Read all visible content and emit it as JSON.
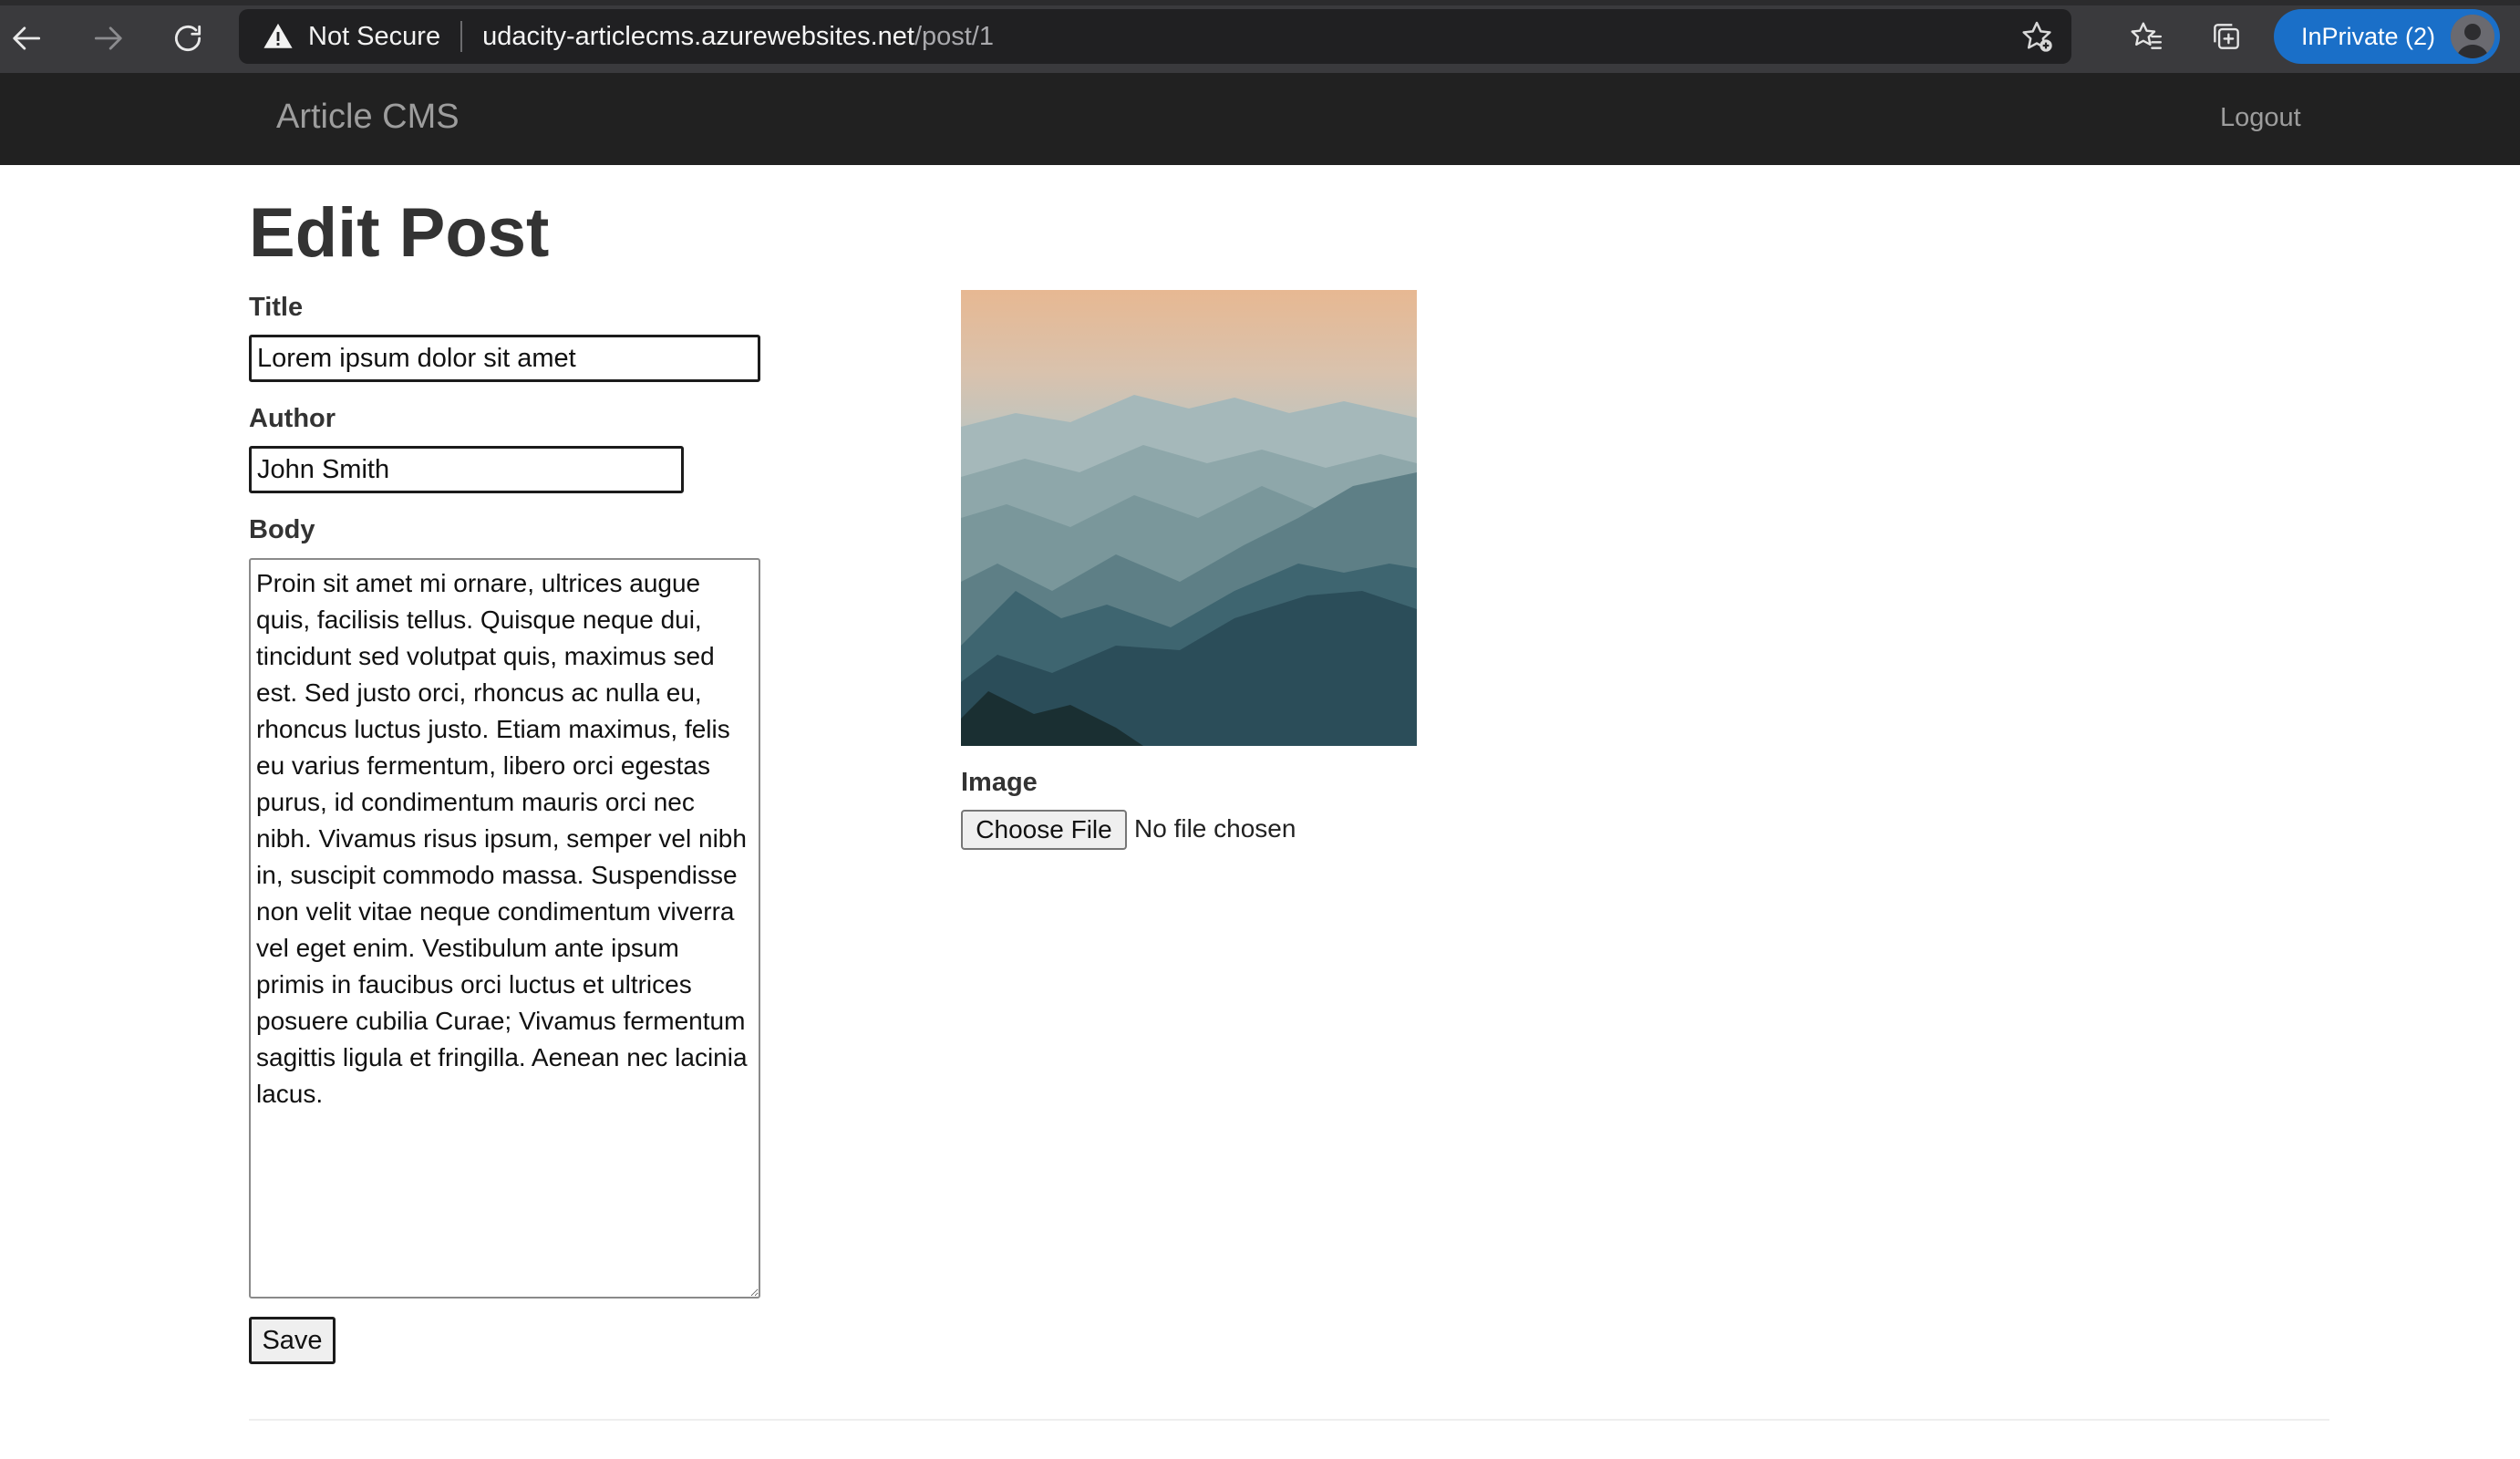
{
  "browser": {
    "security_label": "Not Secure",
    "url_host": "udacity-articlecms.azurewebsites.net",
    "url_path": "/post/1",
    "inprivate_label": "InPrivate (2)"
  },
  "nav": {
    "brand": "Article CMS",
    "logout": "Logout"
  },
  "form": {
    "heading": "Edit Post",
    "title_label": "Title",
    "title_value": "Lorem ipsum dolor sit amet",
    "author_label": "Author",
    "author_value": "John Smith",
    "body_label": "Body",
    "body_value": "Proin sit amet mi ornare, ultrices augue quis, facilisis tellus. Quisque neque dui, tincidunt sed volutpat quis, maximus sed est. Sed justo orci, rhoncus ac nulla eu, rhoncus luctus justo. Etiam maximus, felis eu varius fermentum, libero orci egestas purus, id condimentum mauris orci nec nibh. Vivamus risus ipsum, semper vel nibh in, suscipit commodo massa. Suspendisse non velit vitae neque condimentum viverra vel eget enim. Vestibulum ante ipsum primis in faucibus orci luctus et ultrices posuere cubilia Curae; Vivamus fermentum sagittis ligula et fringilla. Aenean nec lacinia lacus.",
    "save_label": "Save",
    "image_label": "Image",
    "choose_file_label": "Choose File",
    "file_status": "No file chosen"
  },
  "colors": {
    "navbar_bg": "#212121",
    "navbar_text": "#9d9d9d",
    "inprivate_bg": "#1a6fc8"
  }
}
